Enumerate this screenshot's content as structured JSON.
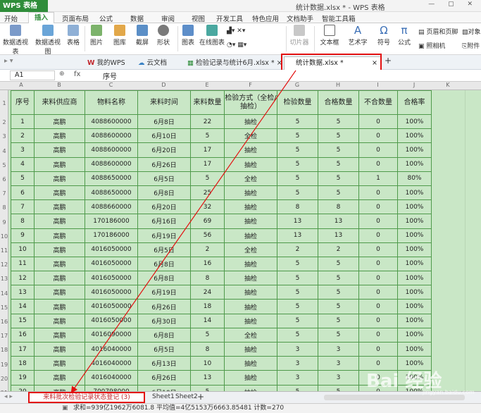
{
  "app": {
    "name": "WPS 表格",
    "doc_title": "统计数据.xlsx * - WPS 表格"
  },
  "menu": {
    "items": [
      "开始",
      "插入",
      "页面布局",
      "公式",
      "数据",
      "审阅",
      "视图",
      "开发工具",
      "特色应用",
      "文档助手",
      "智能工具箱"
    ],
    "active": "插入"
  },
  "ribbon": {
    "pivot_table": "数据透视表",
    "pivot_chart": "数据透视图",
    "table": "表格",
    "picture": "图片",
    "gallery": "图库",
    "screenshot": "截屏",
    "shape": "形状",
    "chart": "图表",
    "online_chart": "在线图表",
    "slicer": "切片器",
    "textbox": "文本框",
    "art_text": "艺术字",
    "symbol": "符号",
    "formula": "公式",
    "header_footer": "页眉和页脚",
    "object": "对象",
    "camera": "照相机",
    "attachment": "附件"
  },
  "tabs": {
    "my_wps": "我的WPS",
    "cloud": "云文档",
    "file1": "检验记录与统计6月.xlsx *",
    "file2": "统计数据.xlsx *"
  },
  "formula": {
    "cell": "A1",
    "fx": "fx",
    "value": "序号"
  },
  "columns": [
    "A",
    "B",
    "C",
    "D",
    "E",
    "F",
    "G",
    "H",
    "I",
    "J",
    "K"
  ],
  "row_numbers": [
    "1",
    "2",
    "3",
    "4",
    "5",
    "6",
    "7",
    "8",
    "9",
    "10",
    "11",
    "12",
    "13",
    "14",
    "15",
    "16",
    "17",
    "18",
    "19",
    "20",
    "21"
  ],
  "table": {
    "headers": [
      "序号",
      "来料供应商",
      "物料名称",
      "来料时间",
      "来料数量",
      "检验方式（全检/抽检）",
      "检验数量",
      "合格数量",
      "不合数量",
      "合格率"
    ],
    "rows": [
      [
        "1",
        "高鹏",
        "4088600000",
        "6月8日",
        "22",
        "抽检",
        "5",
        "5",
        "0",
        "100%"
      ],
      [
        "2",
        "高鹏",
        "4088600000",
        "6月10日",
        "5",
        "全检",
        "5",
        "5",
        "0",
        "100%"
      ],
      [
        "3",
        "高鹏",
        "4088600000",
        "6月20日",
        "17",
        "抽检",
        "5",
        "5",
        "0",
        "100%"
      ],
      [
        "4",
        "高鹏",
        "4088600000",
        "6月26日",
        "17",
        "抽检",
        "5",
        "5",
        "0",
        "100%"
      ],
      [
        "5",
        "高鹏",
        "4088650000",
        "6月5日",
        "5",
        "全检",
        "5",
        "5",
        "1",
        "80%"
      ],
      [
        "6",
        "高鹏",
        "4088650000",
        "6月8日",
        "25",
        "抽检",
        "5",
        "5",
        "0",
        "100%"
      ],
      [
        "7",
        "高鹏",
        "4088660000",
        "6月20日",
        "32",
        "抽检",
        "8",
        "8",
        "0",
        "100%"
      ],
      [
        "8",
        "高鹏",
        "170186000",
        "6月16日",
        "69",
        "抽检",
        "13",
        "13",
        "0",
        "100%"
      ],
      [
        "9",
        "高鹏",
        "170186000",
        "6月19日",
        "56",
        "抽检",
        "13",
        "13",
        "0",
        "100%"
      ],
      [
        "10",
        "高鹏",
        "4016050000",
        "6月5日",
        "2",
        "全检",
        "2",
        "2",
        "0",
        "100%"
      ],
      [
        "11",
        "高鹏",
        "4016050000",
        "6月8日",
        "16",
        "抽检",
        "5",
        "5",
        "0",
        "100%"
      ],
      [
        "12",
        "高鹏",
        "4016050000",
        "6月8日",
        "8",
        "抽检",
        "5",
        "5",
        "0",
        "100%"
      ],
      [
        "13",
        "高鹏",
        "4016050000",
        "6月19日",
        "24",
        "抽检",
        "5",
        "5",
        "0",
        "100%"
      ],
      [
        "14",
        "高鹏",
        "4016050000",
        "6月26日",
        "18",
        "抽检",
        "5",
        "5",
        "0",
        "100%"
      ],
      [
        "15",
        "高鹏",
        "4016050000",
        "6月30日",
        "14",
        "抽检",
        "5",
        "5",
        "0",
        "100%"
      ],
      [
        "16",
        "高鹏",
        "4016090000",
        "6月8日",
        "5",
        "全检",
        "5",
        "5",
        "0",
        "100%"
      ],
      [
        "17",
        "高鹏",
        "4016040000",
        "6月5日",
        "8",
        "抽检",
        "3",
        "3",
        "0",
        "100%"
      ],
      [
        "18",
        "高鹏",
        "4016040000",
        "6月13日",
        "10",
        "抽检",
        "3",
        "3",
        "0",
        "100%"
      ],
      [
        "19",
        "高鹏",
        "4016040000",
        "6月26日",
        "13",
        "抽检",
        "3",
        "3",
        "0",
        "100%"
      ],
      [
        "20",
        "高鹏",
        "700798000",
        "6月10日",
        "5",
        "抽检",
        "5",
        "5",
        "0",
        "100%"
      ]
    ]
  },
  "sheets": {
    "active": "来料批次检验记录状态登记 (3)",
    "others": [
      "Sheet1",
      "Sheet2"
    ],
    "add": "+"
  },
  "status": {
    "text": "求和=939亿1962万6081.8  平均值=4亿5153万6663.85481  计数=270"
  },
  "watermark": {
    "text": "Bai 经验",
    "sub": "jingyan.baidu.com"
  },
  "colors": {
    "accent": "#2f8d3a",
    "highlight": "#e31010",
    "cell_fill": "#c9e7c6",
    "border": "#4f9a4b"
  }
}
